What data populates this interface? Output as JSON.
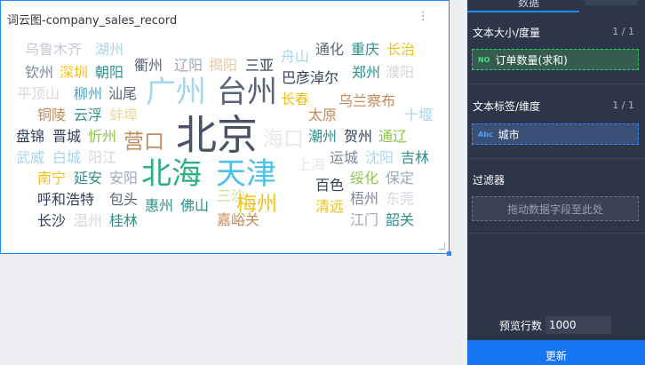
{
  "card": {
    "title": "词云图-company_sales_record",
    "menu_glyph": "⋮"
  },
  "chart_data": {
    "type": "wordcloud",
    "words": [
      {
        "text": "乌鲁木齐",
        "weight": 2,
        "color": "#c6c9d3"
      },
      {
        "text": "湖州",
        "weight": 2,
        "color": "#a7d5ec"
      },
      {
        "text": "衢州",
        "weight": 2,
        "color": "#5b6478"
      },
      {
        "text": "辽阳",
        "weight": 2,
        "color": "#9fa7b8"
      },
      {
        "text": "揭阳",
        "weight": 2,
        "color": "#e9c8a4"
      },
      {
        "text": "三亚",
        "weight": 2,
        "color": "#2f3f55"
      },
      {
        "text": "舟山",
        "weight": 2,
        "color": "#a7d5ec"
      },
      {
        "text": "通化",
        "weight": 2,
        "color": "#5b6478"
      },
      {
        "text": "重庆",
        "weight": 2,
        "color": "#2f8f8a"
      },
      {
        "text": "长治",
        "weight": 2,
        "color": "#f3c11a"
      },
      {
        "text": "钦州",
        "weight": 2,
        "color": "#7d8698"
      },
      {
        "text": "深圳",
        "weight": 2,
        "color": "#f3c11a"
      },
      {
        "text": "朝阳",
        "weight": 2,
        "color": "#2f8f8a"
      },
      {
        "text": "巴彦淖尔",
        "weight": 2,
        "color": "#2f3f55"
      },
      {
        "text": "郑州",
        "weight": 2,
        "color": "#2f8f8a"
      },
      {
        "text": "濮阳",
        "weight": 2,
        "color": "#d6d8df"
      },
      {
        "text": "平顶山",
        "weight": 2,
        "color": "#d6d8df"
      },
      {
        "text": "柳州",
        "weight": 2,
        "color": "#4aa6d0"
      },
      {
        "text": "汕尾",
        "weight": 2,
        "color": "#5b6478"
      },
      {
        "text": "广州",
        "weight": 4,
        "color": "#a7d5ec"
      },
      {
        "text": "台州",
        "weight": 4,
        "color": "#5b6478"
      },
      {
        "text": "长春",
        "weight": 2,
        "color": "#f3c11a"
      },
      {
        "text": "乌兰察布",
        "weight": 2,
        "color": "#c48a57"
      },
      {
        "text": "铜陵",
        "weight": 2,
        "color": "#c48a57"
      },
      {
        "text": "云浮",
        "weight": 2,
        "color": "#2f8f8a"
      },
      {
        "text": "蚌埠",
        "weight": 2,
        "color": "#e9d9a4"
      },
      {
        "text": "太原",
        "weight": 2,
        "color": "#c48a57"
      },
      {
        "text": "十堰",
        "weight": 2,
        "color": "#a7d5ec"
      },
      {
        "text": "盘锦",
        "weight": 2,
        "color": "#2f3f55"
      },
      {
        "text": "晋城",
        "weight": 2,
        "color": "#2f3f55"
      },
      {
        "text": "忻州",
        "weight": 2,
        "color": "#8bc34a"
      },
      {
        "text": "营口",
        "weight": 3,
        "color": "#c48a57"
      },
      {
        "text": "北京",
        "weight": 5,
        "color": "#4a5268"
      },
      {
        "text": "海口",
        "weight": 3,
        "color": "#e6e8ee"
      },
      {
        "text": "潮州",
        "weight": 2,
        "color": "#2f8f8a"
      },
      {
        "text": "贺州",
        "weight": 2,
        "color": "#2f3f55"
      },
      {
        "text": "通辽",
        "weight": 2,
        "color": "#8bc34a"
      },
      {
        "text": "武威",
        "weight": 2,
        "color": "#a7d5ec"
      },
      {
        "text": "白城",
        "weight": 2,
        "color": "#a7d5ec"
      },
      {
        "text": "阳江",
        "weight": 2,
        "color": "#d6d8df"
      },
      {
        "text": "北海",
        "weight": 4,
        "color": "#2db27f"
      },
      {
        "text": "天津",
        "weight": 4,
        "color": "#4ec1e8"
      },
      {
        "text": "上海",
        "weight": 2,
        "color": "#e6e8ee"
      },
      {
        "text": "运城",
        "weight": 2,
        "color": "#7d8698"
      },
      {
        "text": "沈阳",
        "weight": 2,
        "color": "#a7d5ec"
      },
      {
        "text": "吉林",
        "weight": 2,
        "color": "#2f8f8a"
      },
      {
        "text": "南宁",
        "weight": 2,
        "color": "#f3c11a"
      },
      {
        "text": "延安",
        "weight": 2,
        "color": "#2f8f8a"
      },
      {
        "text": "安阳",
        "weight": 2,
        "color": "#9fa7b8"
      },
      {
        "text": "绥化",
        "weight": 2,
        "color": "#8bc34a"
      },
      {
        "text": "保定",
        "weight": 2,
        "color": "#9fa7b8"
      },
      {
        "text": "呼和浩特",
        "weight": 2,
        "color": "#2f3f55"
      },
      {
        "text": "包头",
        "weight": 2,
        "color": "#5b6478"
      },
      {
        "text": "三沙",
        "weight": 2,
        "color": "#c5e19a"
      },
      {
        "text": "梅州",
        "weight": 3,
        "color": "#f3c11a"
      },
      {
        "text": "百色",
        "weight": 2,
        "color": "#2f3f55"
      },
      {
        "text": "梧州",
        "weight": 2,
        "color": "#7d8698"
      },
      {
        "text": "东莞",
        "weight": 2,
        "color": "#d6d8df"
      },
      {
        "text": "长沙",
        "weight": 2,
        "color": "#2f3f55"
      },
      {
        "text": "温州",
        "weight": 2,
        "color": "#d6d8df"
      },
      {
        "text": "桂林",
        "weight": 2,
        "color": "#2f8f8a"
      },
      {
        "text": "惠州",
        "weight": 2,
        "color": "#2f8f8a"
      },
      {
        "text": "佛山",
        "weight": 2,
        "color": "#2f8f8a"
      },
      {
        "text": "嘉峪关",
        "weight": 2,
        "color": "#c48a57"
      },
      {
        "text": "清远",
        "weight": 2,
        "color": "#f3c11a"
      },
      {
        "text": "江门",
        "weight": 2,
        "color": "#9fa7b8"
      },
      {
        "text": "韶关",
        "weight": 2,
        "color": "#2f8f8a"
      }
    ]
  },
  "panel": {
    "tab_data": "数据",
    "size_section": {
      "label": "文本大小/度量",
      "count": "1 / 1"
    },
    "measure_field": {
      "tag": "NO",
      "label": "订单数量(求和)"
    },
    "label_section": {
      "label": "文本标签/维度",
      "count": "1 / 1"
    },
    "dim_field": {
      "tag": "Abc",
      "label": "城市"
    },
    "filter_section": {
      "label": "过滤器"
    },
    "dropzone": "拖动数据字段至此处",
    "preview": {
      "label": "预览行数",
      "value": "1000"
    },
    "update_button": "更新"
  },
  "colors": {
    "accent": "#1f8bff",
    "panel_bg": "#2d3548",
    "update_button": "#1676f2"
  }
}
